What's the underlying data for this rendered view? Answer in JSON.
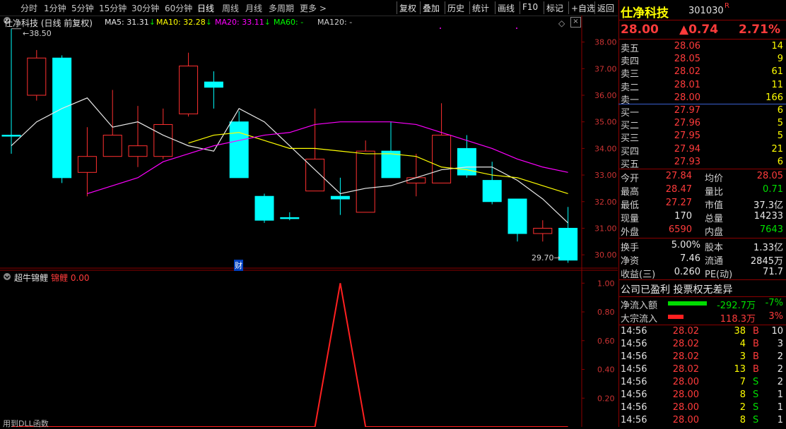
{
  "period_tabs": [
    "分时",
    "1分钟",
    "5分钟",
    "15分钟",
    "30分钟",
    "60分钟",
    "日线",
    "周线",
    "月线",
    "多周期",
    "更多 >"
  ],
  "active_period": "日线",
  "toolbar": [
    "复权",
    "叠加",
    "历史",
    "统计",
    "画线",
    "F10",
    "标记",
    "+自选",
    "返回"
  ],
  "chart_title": "仕净科技 (日线 前复权)",
  "ma_labels": [
    {
      "name": "MA5",
      "value": "31.31",
      "arrow": "↓",
      "color": "#e8e8e8"
    },
    {
      "name": "MA10",
      "value": "32.28",
      "arrow": "↓",
      "color": "#ffff00"
    },
    {
      "name": "MA20",
      "value": "33.11",
      "arrow": "↓",
      "color": "#ff00ff"
    },
    {
      "name": "MA60",
      "value": "-",
      "arrow": "",
      "color": "#00ff00"
    },
    {
      "name": "MA120",
      "value": "-",
      "arrow": "",
      "color": "#cfcfcf"
    }
  ],
  "high_mark": "38.50",
  "low_mark": "29.70",
  "finance_marker": "财",
  "sub_title": "超牛锦鲤",
  "sub_indicator": {
    "name": "锦鲤",
    "value": "0.00"
  },
  "sub_footer": "用到DLL函数",
  "chart_data": [
    {
      "type": "candlestick",
      "ylim": [
        29.5,
        38.6
      ],
      "yticks": [
        30.0,
        31.0,
        32.0,
        33.0,
        34.0,
        35.0,
        36.0,
        37.0,
        38.0
      ],
      "candles": [
        {
          "o": 34.5,
          "c": 34.5,
          "h": 38.5,
          "l": 33.8
        },
        {
          "o": 36.0,
          "c": 37.4,
          "h": 37.7,
          "l": 35.8
        },
        {
          "o": 37.4,
          "c": 32.9,
          "h": 37.5,
          "l": 32.7
        },
        {
          "o": 33.1,
          "c": 33.7,
          "h": 34.8,
          "l": 32.2
        },
        {
          "o": 33.7,
          "c": 34.5,
          "h": 36.2,
          "l": 33.7
        },
        {
          "o": 33.7,
          "c": 34.1,
          "h": 35.6,
          "l": 33.3
        },
        {
          "o": 33.7,
          "c": 34.9,
          "h": 35.5,
          "l": 33.6
        },
        {
          "o": 35.3,
          "c": 37.1,
          "h": 37.6,
          "l": 35.2
        },
        {
          "o": 36.5,
          "c": 36.3,
          "h": 36.9,
          "l": 35.5
        },
        {
          "o": 35.0,
          "c": 32.9,
          "h": 35.4,
          "l": 32.9
        },
        {
          "o": 32.2,
          "c": 31.3,
          "h": 32.3,
          "l": 31.2
        },
        {
          "o": 31.4,
          "c": 31.4,
          "h": 31.6,
          "l": 31.3
        },
        {
          "o": 32.4,
          "c": 33.6,
          "h": 35.5,
          "l": 32.4
        },
        {
          "o": 32.2,
          "c": 32.1,
          "h": 32.9,
          "l": 31.5
        },
        {
          "o": 31.6,
          "c": 33.9,
          "h": 34.3,
          "l": 31.6
        },
        {
          "o": 33.9,
          "c": 32.9,
          "h": 35.0,
          "l": 32.9
        },
        {
          "o": 32.7,
          "c": 32.9,
          "h": 33.8,
          "l": 32.2
        },
        {
          "o": 32.7,
          "c": 34.5,
          "h": 35.7,
          "l": 32.7
        },
        {
          "o": 34.0,
          "c": 33.0,
          "h": 34.5,
          "l": 32.9
        },
        {
          "o": 32.8,
          "c": 32.0,
          "h": 33.5,
          "l": 31.9
        },
        {
          "o": 32.1,
          "c": 30.8,
          "h": 32.1,
          "l": 30.5
        },
        {
          "o": 30.8,
          "c": 31.0,
          "h": 31.3,
          "l": 30.5
        },
        {
          "o": 31.0,
          "c": 29.8,
          "h": 31.8,
          "l": 29.7
        }
      ],
      "ma5": [
        null,
        null,
        null,
        null,
        34.8,
        35.0,
        34.5,
        34.1,
        33.9,
        35.5,
        35.0,
        34.1,
        33.2,
        32.3,
        32.5,
        32.6,
        32.9,
        33.2,
        33.3,
        33.3,
        32.8,
        32.1,
        31.2
      ],
      "ma10": [
        null,
        null,
        null,
        null,
        null,
        null,
        null,
        null,
        null,
        34.6,
        34.3,
        34.0,
        34.0,
        33.9,
        33.8,
        33.8,
        33.7,
        33.3,
        33.2,
        33.0,
        32.9,
        32.6,
        32.3
      ],
      "ma20": [
        null,
        null,
        null,
        null,
        null,
        null,
        null,
        null,
        null,
        null,
        null,
        null,
        null,
        null,
        null,
        null,
        null,
        null,
        null,
        34.0,
        33.6,
        33.3,
        33.1
      ],
      "vol_sp": []
    },
    {
      "type": "line",
      "name": "锦鲤",
      "ylim": [
        0.0,
        1.08
      ],
      "yticks": [
        0.2,
        0.4,
        0.6,
        0.8,
        1.0
      ],
      "values": [
        0,
        0,
        0,
        0,
        0,
        0,
        0,
        0,
        0,
        0,
        0,
        0,
        0,
        1,
        0,
        0,
        0,
        0,
        0,
        0,
        0,
        0,
        0
      ]
    }
  ],
  "quote": {
    "name": "仕净科技",
    "code": "301030",
    "flag": "R",
    "price": "28.00",
    "change": "▲0.74",
    "pct": "2.71%"
  },
  "asks": [
    {
      "label": "卖五",
      "price": "28.06",
      "vol": "14"
    },
    {
      "label": "卖四",
      "price": "28.05",
      "vol": "9"
    },
    {
      "label": "卖三",
      "price": "28.02",
      "vol": "61"
    },
    {
      "label": "卖二",
      "price": "28.01",
      "vol": "11"
    },
    {
      "label": "卖一",
      "price": "28.00",
      "vol": "166"
    }
  ],
  "bids": [
    {
      "label": "买一",
      "price": "27.97",
      "vol": "6"
    },
    {
      "label": "买二",
      "price": "27.96",
      "vol": "5"
    },
    {
      "label": "买三",
      "price": "27.95",
      "vol": "5"
    },
    {
      "label": "买四",
      "price": "27.94",
      "vol": "21"
    },
    {
      "label": "买五",
      "price": "27.93",
      "vol": "6"
    }
  ],
  "stats": [
    {
      "l1": "今开",
      "v1": "27.84",
      "c1": "red",
      "l2": "均价",
      "v2": "28.05",
      "c2": "red"
    },
    {
      "l1": "最高",
      "v1": "28.47",
      "c1": "red",
      "l2": "量比",
      "v2": "0.71",
      "c2": "grn"
    },
    {
      "l1": "最低",
      "v1": "27.27",
      "c1": "red",
      "l2": "市值",
      "v2": "37.3亿",
      "c2": "wht"
    },
    {
      "l1": "现量",
      "v1": "170",
      "c1": "wht",
      "l2": "总量",
      "v2": "14233",
      "c2": "wht"
    },
    {
      "l1": "外盘",
      "v1": "6590",
      "c1": "red",
      "l2": "内盘",
      "v2": "7643",
      "c2": "grn"
    }
  ],
  "fund": [
    {
      "l1": "换手",
      "v1": "5.00%",
      "l2": "股本",
      "v2": "1.33亿"
    },
    {
      "l1": "净资",
      "v1": "7.46",
      "l2": "流通",
      "v2": "2845万"
    },
    {
      "l1": "收益(三)",
      "v1": "0.260",
      "l2": "PE(动)",
      "v2": "71.7"
    }
  ],
  "notice": "公司已盈利 投票权无差异",
  "flows": [
    {
      "label": "净流入额",
      "value": "-292.7万",
      "pct": "-7%",
      "bar_color": "#00dd00",
      "color": "grn",
      "bar_fraction": 1.0
    },
    {
      "label": "大宗流入",
      "value": "118.3万",
      "pct": "3%",
      "bar_color": "#ff2020",
      "color": "red",
      "bar_fraction": 0.4
    }
  ],
  "ticks": [
    {
      "t": "14:56",
      "p": "28.02",
      "v": "38",
      "s": "B",
      "n": "10"
    },
    {
      "t": "14:56",
      "p": "28.02",
      "v": "4",
      "s": "B",
      "n": "3"
    },
    {
      "t": "14:56",
      "p": "28.02",
      "v": "3",
      "s": "B",
      "n": "2"
    },
    {
      "t": "14:56",
      "p": "28.02",
      "v": "13",
      "s": "B",
      "n": "2"
    },
    {
      "t": "14:56",
      "p": "28.00",
      "v": "7",
      "s": "S",
      "n": "2"
    },
    {
      "t": "14:56",
      "p": "28.00",
      "v": "8",
      "s": "S",
      "n": "1"
    },
    {
      "t": "14:56",
      "p": "28.00",
      "v": "2",
      "s": "S",
      "n": "1"
    },
    {
      "t": "14:56",
      "p": "28.00",
      "v": "8",
      "s": "S",
      "n": "1"
    }
  ]
}
